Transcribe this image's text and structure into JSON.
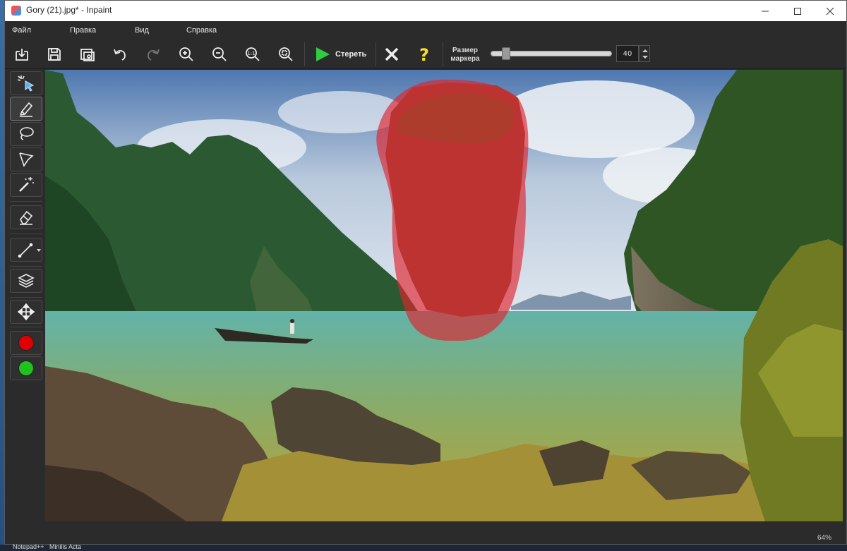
{
  "window": {
    "title": "Gory (21).jpg* - Inpaint",
    "minimize_icon": "minimize-icon",
    "maximize_icon": "maximize-icon",
    "close_icon": "close-icon"
  },
  "menu": [
    "Файл",
    "Правка",
    "Вид",
    "Справка"
  ],
  "toolbar": {
    "erase_label": "Стереть",
    "marker_label_line1": "Размер",
    "marker_label_line2": "маркера",
    "marker_size": "40",
    "marker_slider_fraction": 0.1,
    "erase_color": "#2ecc40",
    "help_color": "#f5e02c"
  },
  "sidebar": {
    "red_color": "#e00000",
    "green_color": "#1fc21f"
  },
  "status": {
    "zoom": "64%"
  },
  "taskbar": [
    "Notepad++",
    "Minilis Acta"
  ],
  "mask": {
    "color": "#e0242e",
    "opacity": 0.65
  }
}
